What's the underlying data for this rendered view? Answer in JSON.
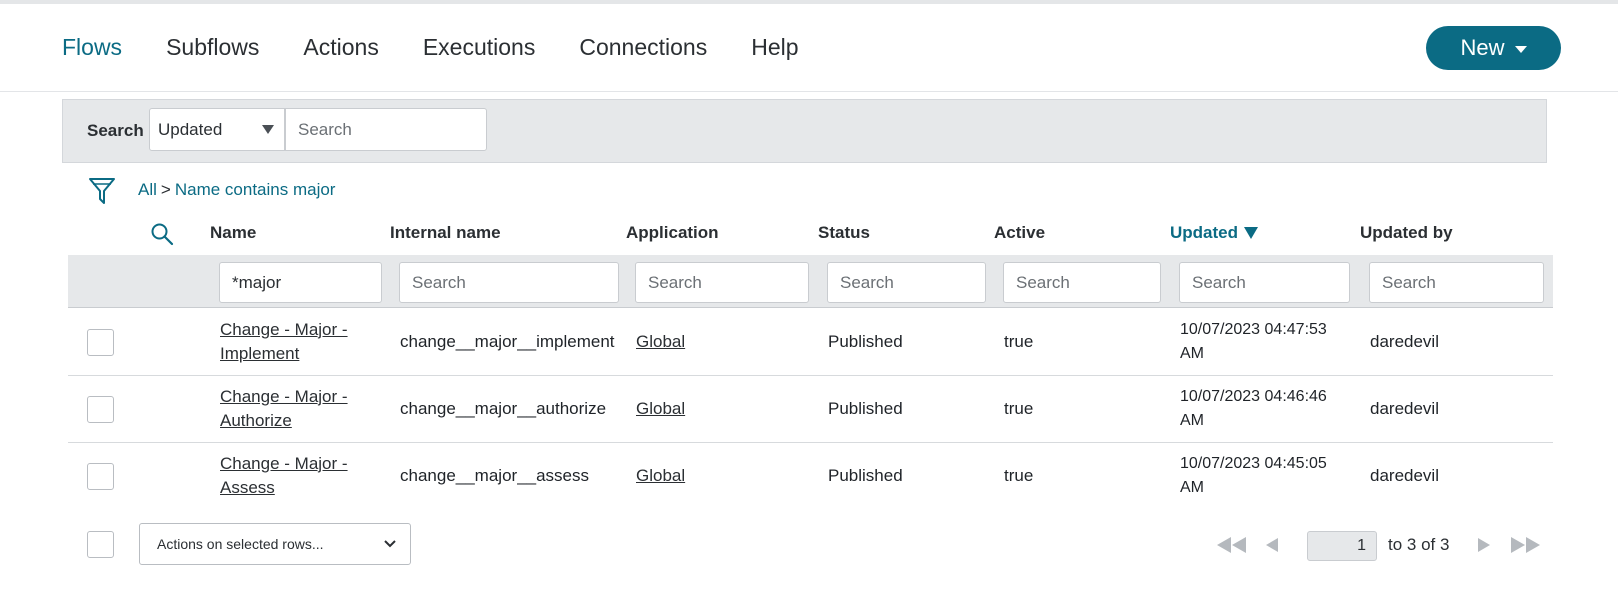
{
  "nav": {
    "items": [
      "Flows",
      "Subflows",
      "Actions",
      "Executions",
      "Connections",
      "Help"
    ],
    "active_index": 0,
    "new_button": "New"
  },
  "search": {
    "label": "Search",
    "field_selected": "Updated",
    "placeholder": "Search"
  },
  "breadcrumb": {
    "all": "All",
    "separator": ">",
    "condition": "Name contains major"
  },
  "table": {
    "columns": [
      "Name",
      "Internal name",
      "Application",
      "Status",
      "Active",
      "Updated",
      "Updated by"
    ],
    "sorted_column": "Updated",
    "sort_direction": "descending",
    "filters": {
      "name": "*major",
      "placeholder": "Search"
    },
    "rows": [
      {
        "name_line1": "Change - Major -",
        "name_line2": "Implement",
        "internal_name": "change__major__implement",
        "application": "Global",
        "status": "Published",
        "active": "true",
        "updated_line1": "10/07/2023 04:47:53",
        "updated_line2": "AM",
        "updated_by": "daredevil"
      },
      {
        "name_line1": "Change - Major -",
        "name_line2": "Authorize",
        "internal_name": "change__major__authorize",
        "application": "Global",
        "status": "Published",
        "active": "true",
        "updated_line1": "10/07/2023 04:46:46",
        "updated_line2": "AM",
        "updated_by": "daredevil"
      },
      {
        "name_line1": "Change - Major -",
        "name_line2": "Assess",
        "internal_name": "change__major__assess",
        "application": "Global",
        "status": "Published",
        "active": "true",
        "updated_line1": "10/07/2023 04:45:05",
        "updated_line2": "AM",
        "updated_by": "daredevil"
      }
    ]
  },
  "footer": {
    "actions_label": "Actions on selected rows...",
    "page": "1",
    "range_text": "to 3 of 3"
  },
  "colors": {
    "accent": "#0b6b84",
    "filter_bg": "#e6e8ea"
  }
}
